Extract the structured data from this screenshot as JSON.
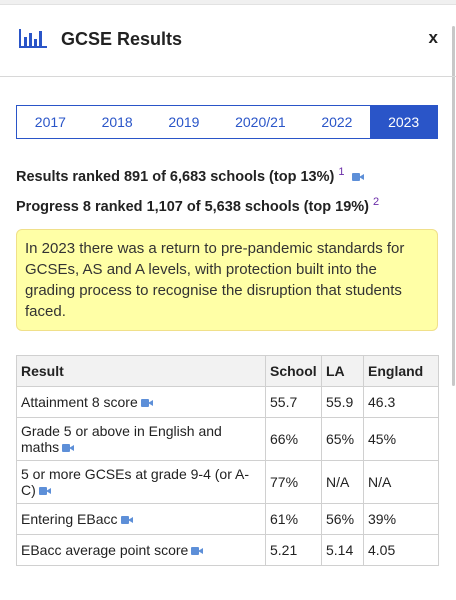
{
  "header": {
    "title": "GCSE Results",
    "close_label": "x",
    "icon": "bar-chart-icon"
  },
  "years": [
    {
      "label": "2017",
      "active": false
    },
    {
      "label": "2018",
      "active": false
    },
    {
      "label": "2019",
      "active": false
    },
    {
      "label": "2020/21",
      "active": false
    },
    {
      "label": "2022",
      "active": false
    },
    {
      "label": "2023",
      "active": true
    }
  ],
  "ranks": {
    "results_text": "Results ranked 891 of 6,683 schools (top 13%)",
    "results_ref": "1",
    "progress_text": "Progress 8 ranked 1,107 of 5,638 schools (top 19%)",
    "progress_ref": "2"
  },
  "note": "In 2023 there was a return to pre-pandemic standards for GCSEs, AS and A levels, with protection built into the grading process to recognise the disruption that students faced.",
  "table": {
    "headers": [
      "Result",
      "School",
      "LA",
      "England"
    ],
    "rows": [
      {
        "label": "Attainment 8 score",
        "school": "55.7",
        "la": "55.9",
        "england": "46.3"
      },
      {
        "label": "Grade 5 or above in English and maths",
        "school": "66%",
        "la": "65%",
        "england": "45%"
      },
      {
        "label": "5 or more GCSEs at grade 9-4 (or A-C)",
        "school": "77%",
        "la": "N/A",
        "england": "N/A"
      },
      {
        "label": "Entering EBacc",
        "school": "61%",
        "la": "56%",
        "england": "39%"
      },
      {
        "label": "EBacc average point score",
        "school": "5.21",
        "la": "5.14",
        "england": "4.05"
      }
    ]
  },
  "colors": {
    "accent": "#2a55c8",
    "note_bg": "#ffffa6",
    "video_icon": "#5d8fd8"
  }
}
